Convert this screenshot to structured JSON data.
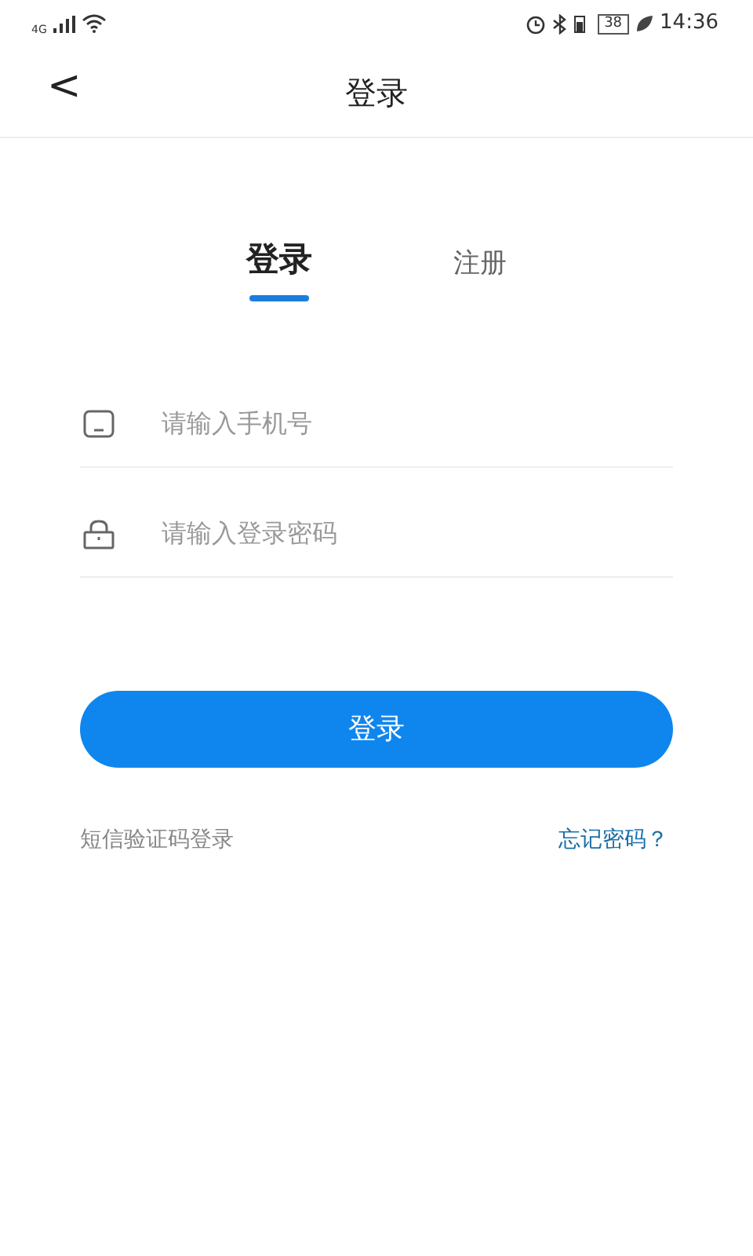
{
  "status_bar": {
    "network": "4G",
    "battery": "38",
    "time": "14:36"
  },
  "header": {
    "back": "<",
    "title": "登录"
  },
  "tabs": [
    {
      "label": "登录",
      "selected": true
    },
    {
      "label": "注册",
      "selected": false
    }
  ],
  "fields": [
    {
      "kind": "phone",
      "placeholder": "请输入手机号"
    },
    {
      "kind": "password",
      "placeholder": "请输入登录密码"
    }
  ],
  "submit": "登录",
  "links": {
    "sms_login": "短信验证码登录",
    "forgot_password": "忘记密码？"
  }
}
